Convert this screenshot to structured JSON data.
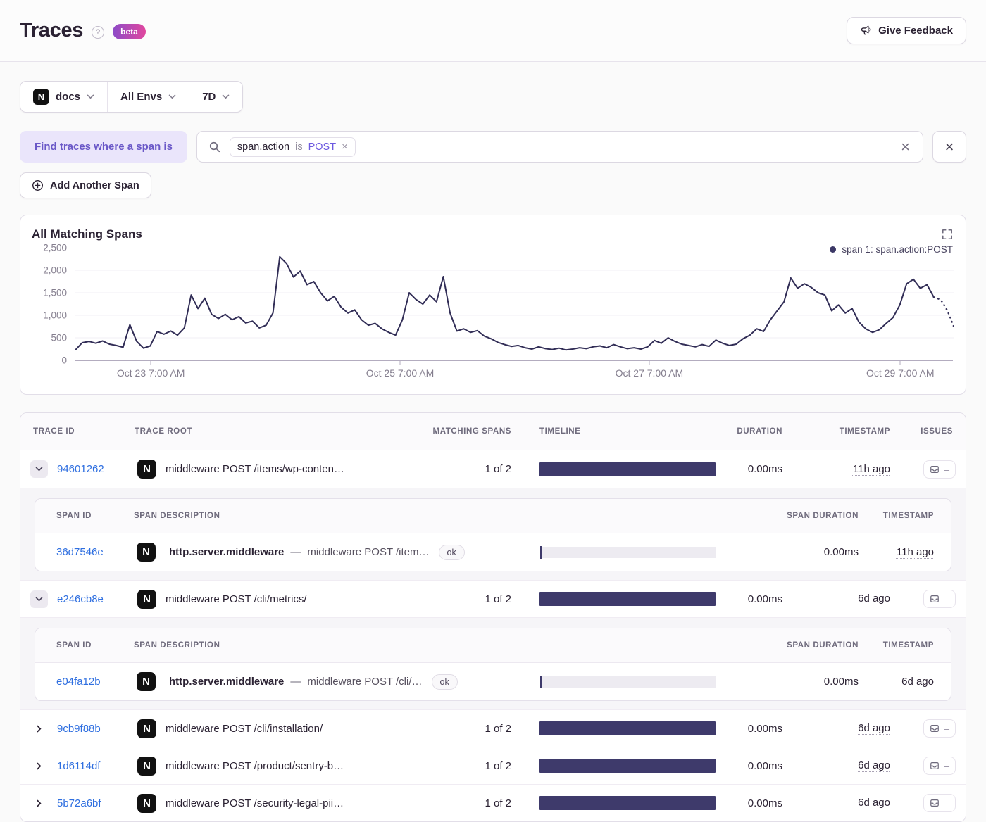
{
  "header": {
    "title": "Traces",
    "beta_label": "beta",
    "feedback_label": "Give Feedback"
  },
  "icons": {
    "project_letter": "N"
  },
  "filters": {
    "project": "docs",
    "environment": "All Envs",
    "date_range": "7D"
  },
  "search": {
    "find_label": "Find traces where a span is",
    "token": {
      "key": "span.action",
      "op": "is",
      "value": "POST",
      "remove": "×"
    },
    "clear_label": "×",
    "dismiss_label": "×",
    "add_span_label": "Add Another Span"
  },
  "chart_data": {
    "type": "line",
    "title": "All Matching Spans",
    "series": [
      {
        "name": "span 1: span.action:POST",
        "color": "#312d56",
        "values": [
          230,
          390,
          420,
          380,
          430,
          360,
          330,
          290,
          790,
          420,
          270,
          320,
          640,
          580,
          650,
          560,
          720,
          1450,
          1150,
          1380,
          1020,
          930,
          1020,
          900,
          970,
          830,
          870,
          720,
          780,
          1050,
          2300,
          2150,
          1850,
          1980,
          1680,
          1750,
          1500,
          1320,
          1420,
          1180,
          1050,
          1120,
          900,
          780,
          820,
          700,
          620,
          560,
          900,
          1500,
          1350,
          1250,
          1450,
          1300,
          1860,
          1050,
          650,
          700,
          620,
          660,
          540,
          480,
          400,
          350,
          310,
          330,
          280,
          250,
          300,
          260,
          240,
          270,
          230,
          250,
          280,
          260,
          300,
          320,
          280,
          350,
          300,
          260,
          280,
          250,
          300,
          440,
          380,
          500,
          420,
          360,
          330,
          300,
          350,
          310,
          450,
          380,
          330,
          360,
          480,
          560,
          700,
          640,
          900,
          1100,
          1300,
          1830,
          1600,
          1700,
          1620,
          1500,
          1450,
          1100,
          1230,
          1050,
          1150,
          850,
          700,
          620,
          680,
          820,
          950,
          1230,
          1700,
          1800,
          1600,
          1680,
          1400,
          1350,
          1100,
          720
        ]
      }
    ],
    "y_ticks": [
      0,
      500,
      1000,
      1500,
      2000,
      2500
    ],
    "ylim": [
      0,
      2500
    ],
    "x_tick_labels": [
      "Oct 23 7:00 AM",
      "Oct 25 7:00 AM",
      "Oct 27 7:00 AM",
      "Oct 29 7:00 AM"
    ],
    "x_tick_fractions": [
      0.086,
      0.37,
      0.654,
      0.94
    ],
    "grid": "horizontal",
    "legend_position": "top-right",
    "dotted_tail_start": 126
  },
  "table": {
    "columns": [
      "Trace ID",
      "Trace Root",
      "Matching Spans",
      "Timeline",
      "Duration",
      "Timestamp",
      "Issues"
    ],
    "span_columns": [
      "Span ID",
      "Span Description",
      "Span Duration",
      "Timestamp"
    ],
    "issues_empty": "–",
    "rows": [
      {
        "trace_id": "94601262",
        "root": "middleware POST /items/wp-conten…",
        "matching_spans": "1 of 2",
        "duration": "0.00ms",
        "timestamp": "11h ago",
        "spans": [
          {
            "span_id": "36d7546e",
            "op": "http.server.middleware",
            "separator": "—",
            "description": "middleware POST /item…",
            "status": "ok",
            "duration": "0.00ms",
            "timestamp": "11h ago"
          }
        ]
      },
      {
        "trace_id": "e246cb8e",
        "root": "middleware POST /cli/metrics/",
        "matching_spans": "1 of 2",
        "duration": "0.00ms",
        "timestamp": "6d ago",
        "spans": [
          {
            "span_id": "e04fa12b",
            "op": "http.server.middleware",
            "separator": "—",
            "description": "middleware POST /cli/…",
            "status": "ok",
            "duration": "0.00ms",
            "timestamp": "6d ago"
          }
        ]
      },
      {
        "trace_id": "9cb9f88b",
        "root": "middleware POST /cli/installation/",
        "matching_spans": "1 of 2",
        "duration": "0.00ms",
        "timestamp": "6d ago"
      },
      {
        "trace_id": "1d6114df",
        "root": "middleware POST /product/sentry-b…",
        "matching_spans": "1 of 2",
        "duration": "0.00ms",
        "timestamp": "6d ago"
      },
      {
        "trace_id": "5b72a6bf",
        "root": "middleware POST /security-legal-pii…",
        "matching_spans": "1 of 2",
        "duration": "0.00ms",
        "timestamp": "6d ago"
      }
    ]
  }
}
